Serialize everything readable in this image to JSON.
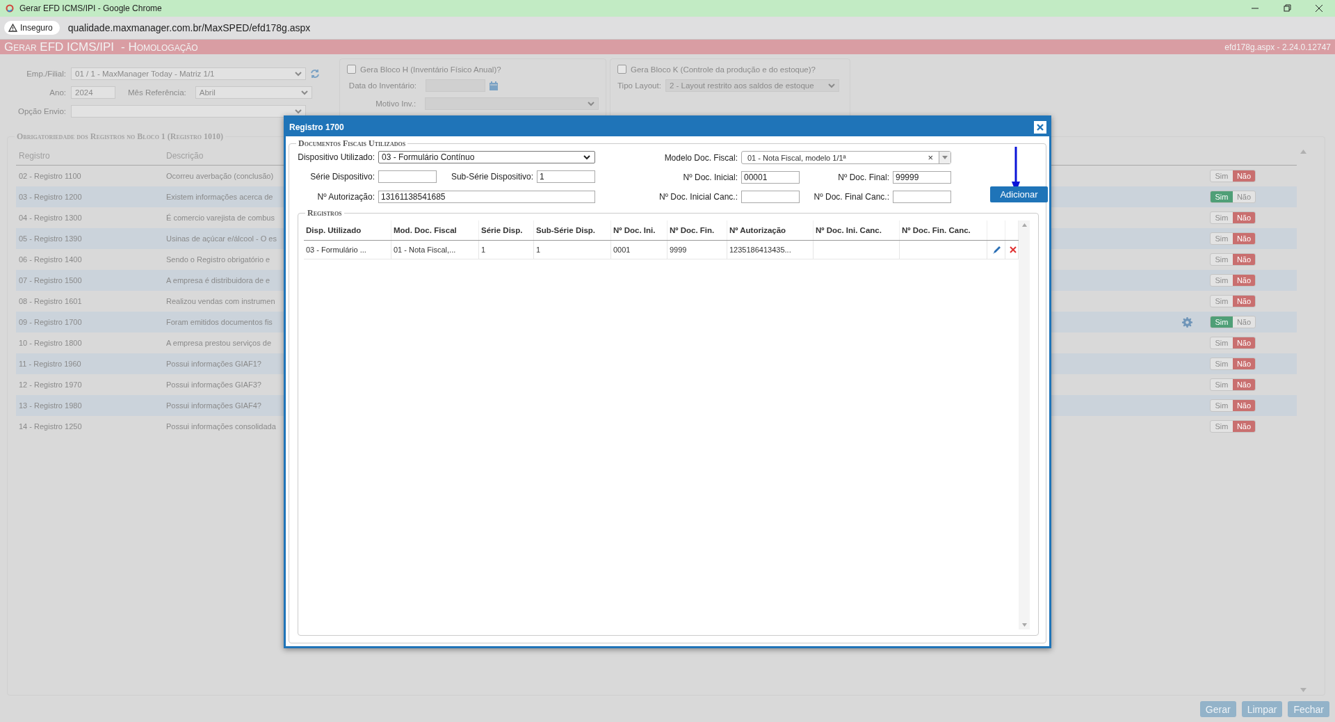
{
  "browser": {
    "title": "Gerar EFD ICMS/IPI - Google Chrome",
    "security": "Inseguro",
    "url": "qualidade.maxmanager.com.br/MaxSPED/efd178g.aspx"
  },
  "page_header": {
    "title": "Gerar EFD ICMS/IPI",
    "subtitle": "- Homologação",
    "version": "efd178g.aspx - 2.24.0.12747"
  },
  "filters": {
    "emp_filial": {
      "label": "Emp./Filial:",
      "value": "01 / 1 - MaxManager Today - Matriz 1/1"
    },
    "ano": {
      "label": "Ano:",
      "value": "2024"
    },
    "mes": {
      "label": "Mês Referência:",
      "value": "Abril"
    },
    "opcao_envio": {
      "label": "Opção Envio:"
    }
  },
  "bloco_h": {
    "label": "Gera Bloco H (Inventário Físico Anual)?",
    "checked": false,
    "data_inventario": {
      "label": "Data do Inventário:",
      "disabled": true
    },
    "motivo": {
      "label": "Motivo Inv.:",
      "disabled": true
    }
  },
  "bloco_k": {
    "label": "Gera Bloco K (Controle da produção e do estoque)?",
    "checked": false,
    "tipo_layout": {
      "label": "Tipo Layout:",
      "value": "2 - Layout restrito aos saldos de estoque",
      "disabled": true
    }
  },
  "registros_bloco1": {
    "legend": "Obrigatoriedade dos Registros no Bloco 1 (Registro 1010)",
    "columns": [
      "Registro",
      "Descrição"
    ],
    "rows": [
      {
        "registro": "02 - Registro 1100",
        "descricao": "Ocorreu averbação (conclusão)",
        "settings": false,
        "on": false,
        "toggle": [
          "Sim",
          "Não"
        ]
      },
      {
        "registro": "03 - Registro 1200",
        "descricao": "Existem informações acerca de",
        "settings": false,
        "on": true,
        "toggle": [
          "Sim",
          "Não"
        ]
      },
      {
        "registro": "04 - Registro 1300",
        "descricao": "É comercio varejista de combus",
        "settings": false,
        "on": false,
        "toggle": [
          "Sim",
          "Não"
        ]
      },
      {
        "registro": "05 - Registro 1390",
        "descricao": "Usinas de açúcar e/álcool - O es",
        "settings": false,
        "on": false,
        "toggle": [
          "Sim",
          "Não"
        ]
      },
      {
        "registro": "06 - Registro 1400",
        "descricao": "Sendo o Registro obrigatório e",
        "settings": false,
        "on": false,
        "toggle": [
          "Sim",
          "Não"
        ]
      },
      {
        "registro": "07 - Registro 1500",
        "descricao": "A empresa é distribuidora de e",
        "settings": false,
        "on": false,
        "toggle": [
          "Sim",
          "Não"
        ]
      },
      {
        "registro": "08 - Registro 1601",
        "descricao": "Realizou vendas com instrumen",
        "settings": false,
        "on": false,
        "toggle": [
          "Sim",
          "Não"
        ]
      },
      {
        "registro": "09 - Registro 1700",
        "descricao": "Foram emitidos documentos fis",
        "settings": true,
        "on": true,
        "toggle": [
          "Sim",
          "Não"
        ]
      },
      {
        "registro": "10 - Registro 1800",
        "descricao": "A empresa prestou serviços de",
        "settings": false,
        "on": false,
        "toggle": [
          "Sim",
          "Não"
        ]
      },
      {
        "registro": "11 - Registro 1960",
        "descricao": "Possui informações GIAF1?",
        "settings": false,
        "on": false,
        "toggle": [
          "Sim",
          "Não"
        ]
      },
      {
        "registro": "12 - Registro 1970",
        "descricao": "Possui informações GIAF3?",
        "settings": false,
        "on": false,
        "toggle": [
          "Sim",
          "Não"
        ]
      },
      {
        "registro": "13 - Registro 1980",
        "descricao": "Possui informações GIAF4?",
        "settings": false,
        "on": false,
        "toggle": [
          "Sim",
          "Não"
        ]
      },
      {
        "registro": "14 - Registro 1250",
        "descricao": "Possui informações consolidada",
        "settings": false,
        "on": false,
        "toggle": [
          "Sim",
          "Não"
        ]
      }
    ]
  },
  "modal": {
    "title": "Registro 1700",
    "legend": "Documentos Fiscais Utilizados",
    "dispositivo": {
      "label": "Dispositivo Utilizado:",
      "value": "03 - Formulário Contínuo"
    },
    "modelo": {
      "label": "Modelo Doc. Fiscal:",
      "value": "01 - Nota Fiscal, modelo 1/1ª",
      "clear": "×"
    },
    "serie": {
      "label": "Série Dispositivo:"
    },
    "sub_serie": {
      "label": "Sub-Série Dispositivo:",
      "value": "1"
    },
    "doc_inicial": {
      "label": "Nº Doc. Inicial:",
      "value": "00001"
    },
    "doc_final": {
      "label": "Nº Doc. Final:",
      "value": "99999"
    },
    "autorizacao": {
      "label": "Nº Autorização:",
      "value": "13161138541685"
    },
    "doc_inicial_canc": {
      "label": "Nº Doc. Inicial Canc.:"
    },
    "doc_final_canc": {
      "label": "Nº Doc. Final Canc.:"
    },
    "add_button": "Adicionar",
    "registros": {
      "legend": "Registros",
      "columns": [
        "Disp. Utilizado",
        "Mod. Doc. Fiscal",
        "Série Disp.",
        "Sub-Série Disp.",
        "Nº Doc. Ini.",
        "Nº Doc. Fin.",
        "Nº Autorização",
        "Nº Doc. Ini. Canc.",
        "Nº Doc. Fin. Canc."
      ],
      "rows": [
        {
          "cells": [
            "03 - Formulário ...",
            "01 - Nota Fiscal,...",
            "1",
            "1",
            "0001",
            "9999",
            "1235186413435...",
            "",
            ""
          ]
        }
      ]
    }
  },
  "buttons": [
    "Gerar",
    "Limpar",
    "Fechar"
  ]
}
